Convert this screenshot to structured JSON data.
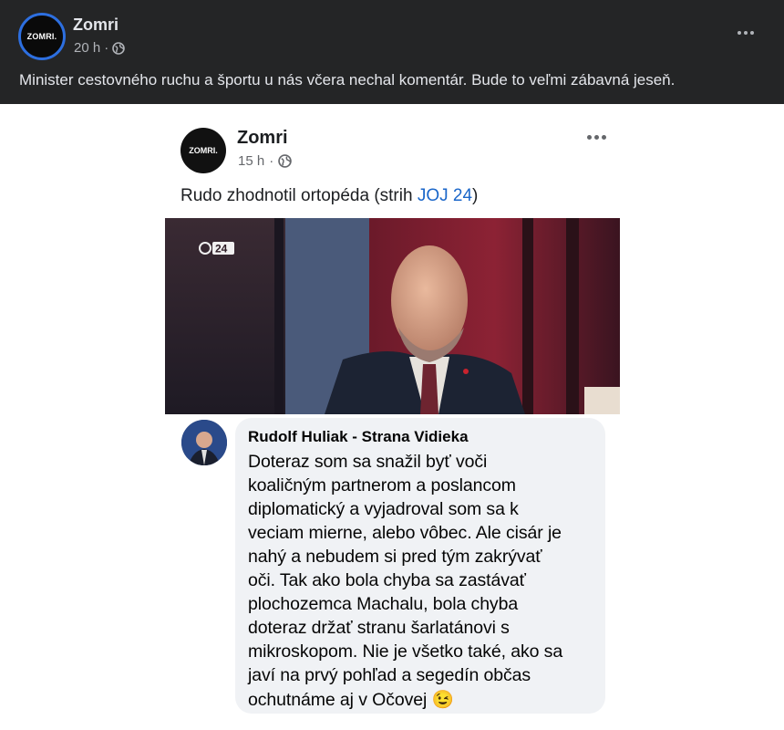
{
  "post": {
    "author": "Zomri",
    "avatar_text": "ZOMRI.",
    "time": "20 h",
    "separator": "·",
    "caption": "Minister cestovného ruchu a športu u nás včera nechal komentár. Bude to veľmi zábavná jeseň."
  },
  "shared": {
    "author": "Zomri",
    "avatar_text": "ZOMRI.",
    "time": "15 h",
    "separator": "·",
    "text_prefix": "Rudo zhodnotil ortopéda (strih ",
    "text_highlight": "JOJ 24",
    "text_suffix": ")",
    "highlight_color": "#1a66c9",
    "video_logo": "24"
  },
  "comment": {
    "name": "Rudolf Huliak - Strana Vidieka",
    "lines": [
      "Doteraz som sa snažil byť voči",
      "koaličným partnerom a poslancom",
      "diplomatický a vyjadroval som sa k",
      "veciam mierne, alebo vôbec. Ale cisár je",
      "nahý a nebudem si pred tým zakrývať",
      "oči. Tak ako bola chyba sa zastávať",
      "plochozemca Machalu, bola chyba",
      "doteraz držať stranu šarlatánovi s",
      "mikroskopom. Nie je všetko také, ako sa",
      "javí na prvý pohľad a segedín občas",
      "ochutnáme aj v Očovej"
    ],
    "emoji": "😉"
  },
  "colors": {
    "background": "#242526",
    "accent_ring": "#2d6fe0",
    "bubble": "#f0f2f5"
  }
}
